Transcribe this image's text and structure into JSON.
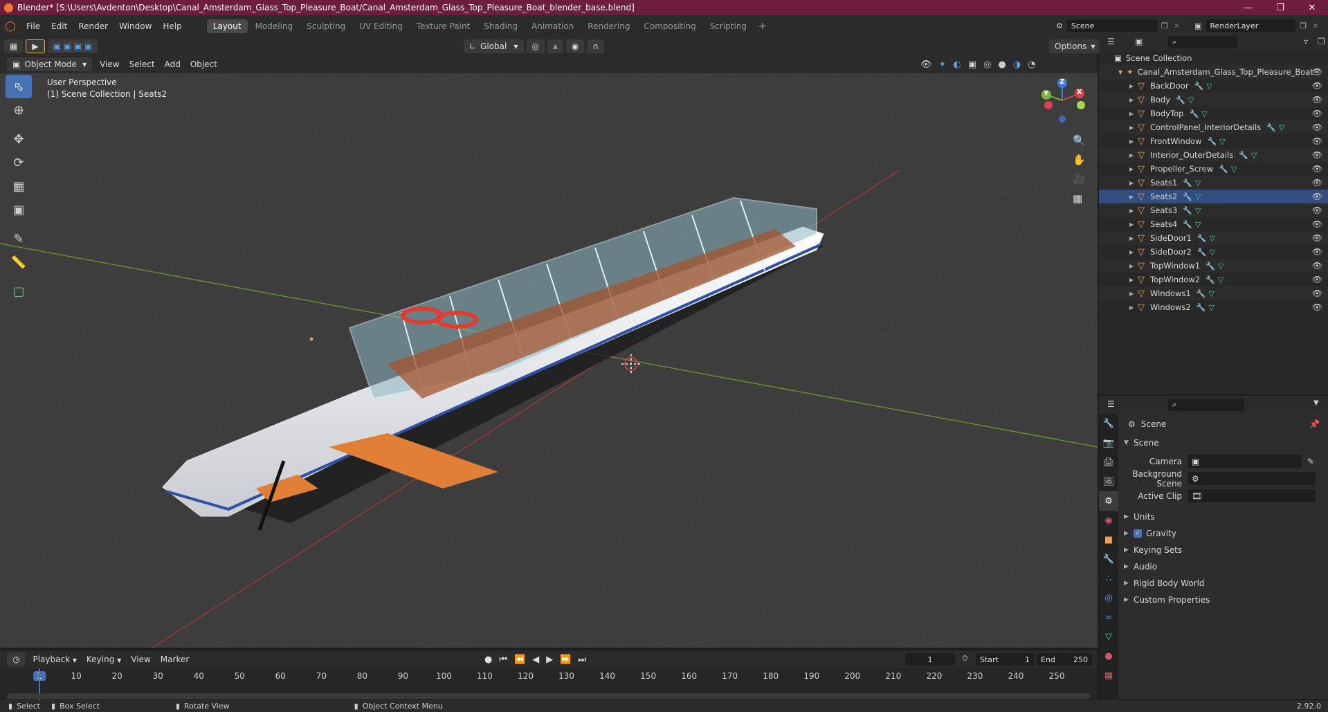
{
  "window": {
    "title": "Blender* [S:\\Users\\Avdenton\\Desktop\\Canal_Amsterdam_Glass_Top_Pleasure_Boat/Canal_Amsterdam_Glass_Top_Pleasure_Boat_blender_base.blend]"
  },
  "menu": [
    "File",
    "Edit",
    "Render",
    "Window",
    "Help"
  ],
  "workspaces": [
    "Layout",
    "Modeling",
    "Sculpting",
    "UV Editing",
    "Texture Paint",
    "Shading",
    "Animation",
    "Rendering",
    "Compositing",
    "Scripting"
  ],
  "active_workspace": "Layout",
  "scene_field": "Scene",
  "render_layer_field": "RenderLayer",
  "tool_header": {
    "orientation": "Global",
    "options": "Options"
  },
  "viewport_header": {
    "mode": "Object Mode",
    "menus": [
      "View",
      "Select",
      "Add",
      "Object"
    ]
  },
  "viewport": {
    "perspective": "User Perspective",
    "collection_info": "(1) Scene Collection | Seats2",
    "gizmo": {
      "x": "X",
      "y": "Y",
      "z": "Z"
    }
  },
  "outliner": {
    "root": "Scene Collection",
    "collection": "Canal_Amsterdam_Glass_Top_Pleasure_Boat",
    "objects": [
      "BackDoor",
      "Body",
      "BodyTop",
      "ControlPanel_InteriorDetails",
      "FrontWindow",
      "Interior_OuterDetails",
      "Propeller_Screw",
      "Seats1",
      "Seats2",
      "Seats3",
      "Seats4",
      "SideDoor1",
      "SideDoor2",
      "TopWindow1",
      "TopWindow2",
      "Windows1",
      "Windows2"
    ],
    "selected": "Seats2"
  },
  "properties": {
    "context_title": "Scene",
    "panel_title": "Scene",
    "fields": {
      "camera": "Camera",
      "background_scene": "Background Scene",
      "active_clip": "Active Clip"
    },
    "collapsed_panels": [
      "Units",
      "Gravity",
      "Keying Sets",
      "Audio",
      "Rigid Body World",
      "Custom Properties"
    ],
    "gravity_checked": true
  },
  "timeline": {
    "menus": [
      "Playback",
      "Keying",
      "View",
      "Marker"
    ],
    "current_frame": "1",
    "start_label": "Start",
    "start": "1",
    "end_label": "End",
    "end": "250",
    "frame_ticks": [
      "1",
      "10",
      "20",
      "30",
      "40",
      "50",
      "60",
      "70",
      "80",
      "90",
      "100",
      "110",
      "120",
      "130",
      "140",
      "150",
      "160",
      "170",
      "180",
      "190",
      "200",
      "210",
      "220",
      "230",
      "240",
      "250"
    ]
  },
  "statusbar": {
    "select": "Select",
    "box_select": "Box Select",
    "rotate_view": "Rotate View",
    "context_menu": "Object Context Menu",
    "version": "2.92.0"
  },
  "colors": {
    "titlebar": "#6f1d3c",
    "accent": "#4772b3",
    "object_orange": "#f29f4a",
    "mesh_green": "#36d6a0",
    "modifier_blue": "#5c9ee6"
  }
}
